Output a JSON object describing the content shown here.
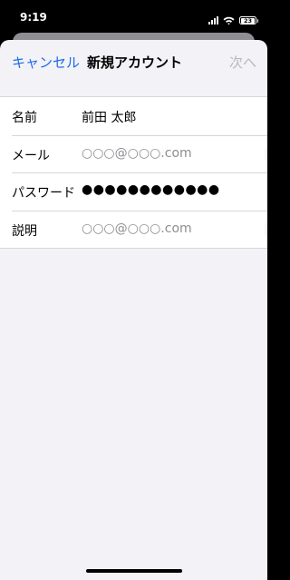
{
  "status_bar": {
    "time": "9:19",
    "battery_level": "23",
    "icons": [
      "signal-icon",
      "wifi-icon",
      "battery-icon"
    ]
  },
  "nav": {
    "cancel_label": "キャンセル",
    "title": "新規アカウント",
    "next_label": "次へ"
  },
  "form": {
    "rows": [
      {
        "label": "名前",
        "value": "前田 太郎",
        "kind": "text"
      },
      {
        "label": "メール",
        "value": "○○○@○○○.com",
        "kind": "placeholder"
      },
      {
        "label": "パスワード",
        "value": "●●●●●●●●●●●●",
        "kind": "secure"
      },
      {
        "label": "説明",
        "value": "○○○@○○○.com",
        "kind": "placeholder"
      }
    ]
  },
  "colors": {
    "accent": "#1e6be6",
    "disabled": "#b8b8bd",
    "background": "#f2f2f7",
    "placeholder": "#8e8e93"
  }
}
